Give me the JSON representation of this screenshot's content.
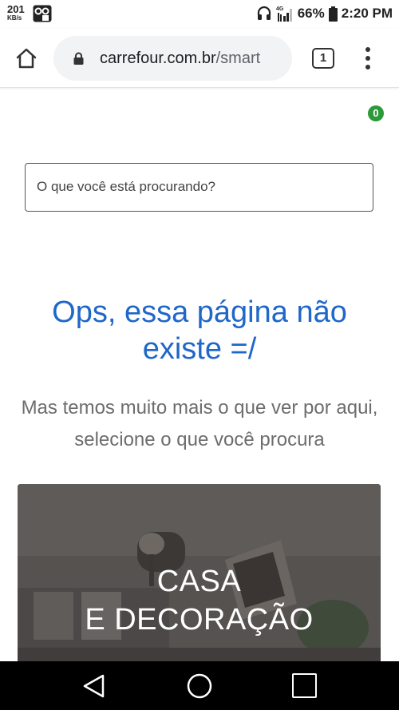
{
  "status_bar": {
    "net_speed": "201",
    "net_speed_unit": "KB/s",
    "network_type": "4G",
    "battery": "66%",
    "time": "2:20 PM",
    "icons": [
      "oo-app-icon",
      "headphones-icon",
      "signal-icon",
      "battery-icon"
    ]
  },
  "browser": {
    "url_domain": "carrefour.com.br",
    "url_path": "/smart",
    "tab_count": "1",
    "icons": [
      "home-icon",
      "lock-icon",
      "tab-switcher-icon",
      "more-menu-icon"
    ]
  },
  "page": {
    "cart_count": "0",
    "search_placeholder": "O que você está procurando?",
    "error_title": "Ops, essa página não existe =/",
    "error_subtitle": "Mas temos muito mais o que ver por aqui, selecione o que você procura",
    "category_card": {
      "title_line1": "CASA",
      "title_line2": "E DECORAÇÃO"
    }
  },
  "colors": {
    "title_blue": "#1f67c8",
    "badge_green": "#2c9a3a",
    "subtitle_gray": "#6d6d6d"
  },
  "nav_bar": {
    "icons": [
      "back-icon",
      "home-circle-icon",
      "recent-apps-icon"
    ]
  }
}
